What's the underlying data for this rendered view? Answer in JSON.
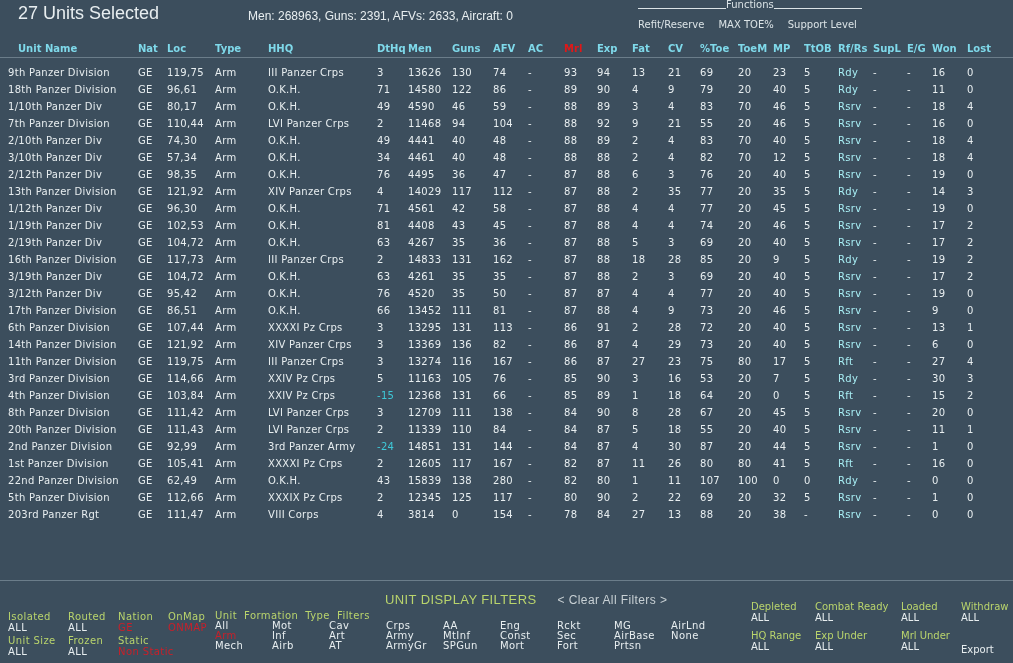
{
  "title": "27 Units Selected",
  "summary": "Men: 268963, Guns: 2391, AFVs: 2633, Aircraft: 0",
  "functions": {
    "label": "Functions",
    "links": [
      "Refit/Reserve",
      "MAX TOE%",
      "Support Level"
    ]
  },
  "table": {
    "columns": [
      {
        "label": "Unit Name",
        "selected": false,
        "kind": "text"
      },
      {
        "label": "Nat",
        "selected": false,
        "kind": "text"
      },
      {
        "label": "Loc",
        "selected": false,
        "kind": "text"
      },
      {
        "label": "Type",
        "selected": false,
        "kind": "text"
      },
      {
        "label": "HHQ",
        "selected": false,
        "kind": "text"
      },
      {
        "label": "DtHq",
        "selected": false,
        "kind": "text"
      },
      {
        "label": "Men",
        "selected": false,
        "kind": "text"
      },
      {
        "label": "Guns",
        "selected": false,
        "kind": "text"
      },
      {
        "label": "AFV",
        "selected": false,
        "kind": "text"
      },
      {
        "label": "AC",
        "selected": false,
        "kind": "text"
      },
      {
        "label": "Mrl",
        "selected": true,
        "kind": "text"
      },
      {
        "label": "Exp",
        "selected": false,
        "kind": "text"
      },
      {
        "label": "Fat",
        "selected": false,
        "kind": "text"
      },
      {
        "label": "CV",
        "selected": false,
        "kind": "text"
      },
      {
        "label": "%Toe",
        "selected": false,
        "kind": "text"
      },
      {
        "label": "ToeM",
        "selected": false,
        "kind": "text"
      },
      {
        "label": "MP",
        "selected": false,
        "kind": "text"
      },
      {
        "label": "TtOB",
        "selected": false,
        "kind": "text"
      },
      {
        "label": "Rf/Rs",
        "selected": false,
        "kind": "status"
      },
      {
        "label": "SupL",
        "selected": false,
        "kind": "text"
      },
      {
        "label": "E/G",
        "selected": false,
        "kind": "text"
      },
      {
        "label": "Won",
        "selected": false,
        "kind": "text"
      },
      {
        "label": "Lost",
        "selected": false,
        "kind": "text"
      }
    ],
    "rows": [
      {
        "dthq_alert": false,
        "cells": [
          "9th Panzer Division",
          "GE",
          "119,75",
          "Arm",
          "III Panzer Crps",
          "3",
          "13626",
          "130",
          "74",
          "-",
          "93",
          "94",
          "13",
          "21",
          "69",
          "20",
          "23",
          "5",
          "Rdy",
          "-",
          "-",
          "16",
          "0"
        ]
      },
      {
        "dthq_alert": false,
        "cells": [
          "18th Panzer Division",
          "GE",
          "96,61",
          "Arm",
          "O.K.H.",
          "71",
          "14580",
          "122",
          "86",
          "-",
          "89",
          "90",
          "4",
          "9",
          "79",
          "20",
          "40",
          "5",
          "Rdy",
          "-",
          "-",
          "11",
          "0"
        ]
      },
      {
        "dthq_alert": false,
        "cells": [
          "1/10th Panzer Div",
          "GE",
          "80,17",
          "Arm",
          "O.K.H.",
          "49",
          "4590",
          "46",
          "59",
          "-",
          "88",
          "89",
          "3",
          "4",
          "83",
          "70",
          "46",
          "5",
          "Rsrv",
          "-",
          "-",
          "18",
          "4"
        ]
      },
      {
        "dthq_alert": false,
        "cells": [
          "7th Panzer Division",
          "GE",
          "110,44",
          "Arm",
          "LVI Panzer Crps",
          "2",
          "11468",
          "94",
          "104",
          "-",
          "88",
          "92",
          "9",
          "21",
          "55",
          "20",
          "46",
          "5",
          "Rsrv",
          "-",
          "-",
          "16",
          "0"
        ]
      },
      {
        "dthq_alert": false,
        "cells": [
          "2/10th Panzer Div",
          "GE",
          "74,30",
          "Arm",
          "O.K.H.",
          "49",
          "4441",
          "40",
          "48",
          "-",
          "88",
          "89",
          "2",
          "4",
          "83",
          "70",
          "40",
          "5",
          "Rsrv",
          "-",
          "-",
          "18",
          "4"
        ]
      },
      {
        "dthq_alert": false,
        "cells": [
          "3/10th Panzer Div",
          "GE",
          "57,34",
          "Arm",
          "O.K.H.",
          "34",
          "4461",
          "40",
          "48",
          "-",
          "88",
          "88",
          "2",
          "4",
          "82",
          "70",
          "12",
          "5",
          "Rsrv",
          "-",
          "-",
          "18",
          "4"
        ]
      },
      {
        "dthq_alert": false,
        "cells": [
          "2/12th Panzer Div",
          "GE",
          "98,35",
          "Arm",
          "O.K.H.",
          "76",
          "4495",
          "36",
          "47",
          "-",
          "87",
          "88",
          "6",
          "3",
          "76",
          "20",
          "40",
          "5",
          "Rsrv",
          "-",
          "-",
          "19",
          "0"
        ]
      },
      {
        "dthq_alert": false,
        "cells": [
          "13th Panzer Division",
          "GE",
          "121,92",
          "Arm",
          "XIV Panzer Crps",
          "4",
          "14029",
          "117",
          "112",
          "-",
          "87",
          "88",
          "2",
          "35",
          "77",
          "20",
          "35",
          "5",
          "Rdy",
          "-",
          "-",
          "14",
          "3"
        ]
      },
      {
        "dthq_alert": false,
        "cells": [
          "1/12th Panzer Div",
          "GE",
          "96,30",
          "Arm",
          "O.K.H.",
          "71",
          "4561",
          "42",
          "58",
          "-",
          "87",
          "88",
          "4",
          "4",
          "77",
          "20",
          "45",
          "5",
          "Rsrv",
          "-",
          "-",
          "19",
          "0"
        ]
      },
      {
        "dthq_alert": false,
        "cells": [
          "1/19th Panzer Div",
          "GE",
          "102,53",
          "Arm",
          "O.K.H.",
          "81",
          "4408",
          "43",
          "45",
          "-",
          "87",
          "88",
          "4",
          "4",
          "74",
          "20",
          "46",
          "5",
          "Rsrv",
          "-",
          "-",
          "17",
          "2"
        ]
      },
      {
        "dthq_alert": false,
        "cells": [
          "2/19th Panzer Div",
          "GE",
          "104,72",
          "Arm",
          "O.K.H.",
          "63",
          "4267",
          "35",
          "36",
          "-",
          "87",
          "88",
          "5",
          "3",
          "69",
          "20",
          "40",
          "5",
          "Rsrv",
          "-",
          "-",
          "17",
          "2"
        ]
      },
      {
        "dthq_alert": false,
        "cells": [
          "16th Panzer Division",
          "GE",
          "117,73",
          "Arm",
          "III Panzer Crps",
          "2",
          "14833",
          "131",
          "162",
          "-",
          "87",
          "88",
          "18",
          "28",
          "85",
          "20",
          "9",
          "5",
          "Rdy",
          "-",
          "-",
          "19",
          "2"
        ]
      },
      {
        "dthq_alert": false,
        "cells": [
          "3/19th Panzer Div",
          "GE",
          "104,72",
          "Arm",
          "O.K.H.",
          "63",
          "4261",
          "35",
          "35",
          "-",
          "87",
          "88",
          "2",
          "3",
          "69",
          "20",
          "40",
          "5",
          "Rsrv",
          "-",
          "-",
          "17",
          "2"
        ]
      },
      {
        "dthq_alert": false,
        "cells": [
          "3/12th Panzer Div",
          "GE",
          "95,42",
          "Arm",
          "O.K.H.",
          "76",
          "4520",
          "35",
          "50",
          "-",
          "87",
          "87",
          "4",
          "4",
          "77",
          "20",
          "40",
          "5",
          "Rsrv",
          "-",
          "-",
          "19",
          "0"
        ]
      },
      {
        "dthq_alert": false,
        "cells": [
          "17th Panzer Division",
          "GE",
          "86,51",
          "Arm",
          "O.K.H.",
          "66",
          "13452",
          "111",
          "81",
          "-",
          "87",
          "88",
          "4",
          "9",
          "73",
          "20",
          "46",
          "5",
          "Rsrv",
          "-",
          "-",
          "9",
          "0"
        ]
      },
      {
        "dthq_alert": false,
        "cells": [
          "6th Panzer Division",
          "GE",
          "107,44",
          "Arm",
          "XXXXI Pz Crps",
          "3",
          "13295",
          "131",
          "113",
          "-",
          "86",
          "91",
          "2",
          "28",
          "72",
          "20",
          "40",
          "5",
          "Rsrv",
          "-",
          "-",
          "13",
          "1"
        ]
      },
      {
        "dthq_alert": false,
        "cells": [
          "14th Panzer Division",
          "GE",
          "121,92",
          "Arm",
          "XIV Panzer Crps",
          "3",
          "13369",
          "136",
          "82",
          "-",
          "86",
          "87",
          "4",
          "29",
          "73",
          "20",
          "40",
          "5",
          "Rsrv",
          "-",
          "-",
          "6",
          "0"
        ]
      },
      {
        "dthq_alert": false,
        "cells": [
          "11th Panzer Division",
          "GE",
          "119,75",
          "Arm",
          "III Panzer Crps",
          "3",
          "13274",
          "116",
          "167",
          "-",
          "86",
          "87",
          "27",
          "23",
          "75",
          "80",
          "17",
          "5",
          "Rft",
          "-",
          "-",
          "27",
          "4"
        ]
      },
      {
        "dthq_alert": false,
        "cells": [
          "3rd Panzer Division",
          "GE",
          "114,66",
          "Arm",
          "XXIV Pz Crps",
          "5",
          "11163",
          "105",
          "76",
          "-",
          "85",
          "90",
          "3",
          "16",
          "53",
          "20",
          "7",
          "5",
          "Rdy",
          "-",
          "-",
          "30",
          "3"
        ]
      },
      {
        "dthq_alert": true,
        "cells": [
          "4th Panzer Division",
          "GE",
          "103,84",
          "Arm",
          "XXIV Pz Crps",
          "-15",
          "12368",
          "131",
          "66",
          "-",
          "85",
          "89",
          "1",
          "18",
          "64",
          "20",
          "0",
          "5",
          "Rft",
          "-",
          "-",
          "15",
          "2"
        ]
      },
      {
        "dthq_alert": false,
        "cells": [
          "8th Panzer Division",
          "GE",
          "111,42",
          "Arm",
          "LVI Panzer Crps",
          "3",
          "12709",
          "111",
          "138",
          "-",
          "84",
          "90",
          "8",
          "28",
          "67",
          "20",
          "45",
          "5",
          "Rsrv",
          "-",
          "-",
          "20",
          "0"
        ]
      },
      {
        "dthq_alert": false,
        "cells": [
          "20th Panzer Division",
          "GE",
          "111,43",
          "Arm",
          "LVI Panzer Crps",
          "2",
          "11339",
          "110",
          "84",
          "-",
          "84",
          "87",
          "5",
          "18",
          "55",
          "20",
          "40",
          "5",
          "Rsrv",
          "-",
          "-",
          "11",
          "1"
        ]
      },
      {
        "dthq_alert": true,
        "cells": [
          "2nd Panzer Division",
          "GE",
          "92,99",
          "Arm",
          "3rd Panzer Army",
          "-24",
          "14851",
          "131",
          "144",
          "-",
          "84",
          "87",
          "4",
          "30",
          "87",
          "20",
          "44",
          "5",
          "Rsrv",
          "-",
          "-",
          "1",
          "0"
        ]
      },
      {
        "dthq_alert": false,
        "cells": [
          "1st Panzer Division",
          "GE",
          "105,41",
          "Arm",
          "XXXXI Pz Crps",
          "2",
          "12605",
          "117",
          "167",
          "-",
          "82",
          "87",
          "11",
          "26",
          "80",
          "80",
          "41",
          "5",
          "Rft",
          "-",
          "-",
          "16",
          "0"
        ]
      },
      {
        "dthq_alert": false,
        "cells": [
          "22nd Panzer Division",
          "GE",
          "62,49",
          "Arm",
          "O.K.H.",
          "43",
          "15839",
          "138",
          "280",
          "-",
          "82",
          "80",
          "1",
          "11",
          "107",
          "100",
          "0",
          "0",
          "Rdy",
          "-",
          "-",
          "0",
          "0"
        ]
      },
      {
        "dthq_alert": false,
        "cells": [
          "5th Panzer Division",
          "GE",
          "112,66",
          "Arm",
          "XXXIX Pz Crps",
          "2",
          "12345",
          "125",
          "117",
          "-",
          "80",
          "90",
          "2",
          "22",
          "69",
          "20",
          "32",
          "5",
          "Rsrv",
          "-",
          "-",
          "1",
          "0"
        ]
      },
      {
        "dthq_alert": false,
        "cells": [
          "203rd Panzer Rgt",
          "GE",
          "111,47",
          "Arm",
          "VIII Corps",
          "4",
          "3814",
          "0",
          "154",
          "-",
          "78",
          "84",
          "27",
          "13",
          "88",
          "20",
          "38",
          "-",
          "Rsrv",
          "-",
          "-",
          "0",
          "0"
        ]
      }
    ]
  },
  "filters": {
    "title": "UNIT DISPLAY FILTERS",
    "clear": "< Clear All Filters >",
    "left": [
      {
        "label": "Isolated",
        "value": "ALL",
        "active": false
      },
      {
        "label": "Routed",
        "value": "ALL",
        "active": false
      },
      {
        "label": "Nation",
        "value": "GE",
        "active": true
      },
      {
        "label": "OnMap",
        "value": "ONMAP",
        "active": true
      },
      {
        "label": "Unit Size",
        "value": "ALL",
        "active": false
      },
      {
        "label": "Frozen",
        "value": "ALL",
        "active": false
      },
      {
        "label": "Static",
        "value": "Non Static",
        "active": true
      }
    ],
    "unit_types": {
      "label": "Unit  Formation  Type  Filters",
      "items": [
        {
          "label": "All",
          "selected": false
        },
        {
          "label": "Arm",
          "selected": true
        },
        {
          "label": "Mech",
          "selected": false
        },
        {
          "label": "Mot",
          "selected": false
        },
        {
          "label": "Inf",
          "selected": false
        },
        {
          "label": "Airb",
          "selected": false
        },
        {
          "label": "Cav",
          "selected": false
        },
        {
          "label": "Art",
          "selected": false
        },
        {
          "label": "AT",
          "selected": false
        },
        {
          "label": "Crps",
          "selected": false
        },
        {
          "label": "Army",
          "selected": false
        },
        {
          "label": "ArmyGr",
          "selected": false
        },
        {
          "label": "AA",
          "selected": false
        },
        {
          "label": "MtInf",
          "selected": false
        },
        {
          "label": "SPGun",
          "selected": false
        },
        {
          "label": "Eng",
          "selected": false
        },
        {
          "label": "Const",
          "selected": false
        },
        {
          "label": "Mort",
          "selected": false
        },
        {
          "label": "Rckt",
          "selected": false
        },
        {
          "label": "Sec",
          "selected": false
        },
        {
          "label": "Fort",
          "selected": false
        },
        {
          "label": "MG",
          "selected": false
        },
        {
          "label": "AirBase",
          "selected": false
        },
        {
          "label": "Prtsn",
          "selected": false
        },
        {
          "label": "AirLnd",
          "selected": false
        },
        {
          "label": "None",
          "selected": false
        }
      ]
    },
    "right": [
      {
        "label": "Depleted",
        "value": "ALL",
        "active": false
      },
      {
        "label": "Combat Ready",
        "value": "ALL",
        "active": false
      },
      {
        "label": "Loaded",
        "value": "ALL",
        "active": false
      },
      {
        "label": "Withdraw",
        "value": "ALL",
        "active": false
      },
      {
        "label": "HQ Range",
        "value": "ALL",
        "active": false
      },
      {
        "label": "Exp Under",
        "value": "ALL",
        "active": false
      },
      {
        "label": "Mrl Under",
        "value": "ALL",
        "active": false
      }
    ],
    "export": "Export"
  }
}
